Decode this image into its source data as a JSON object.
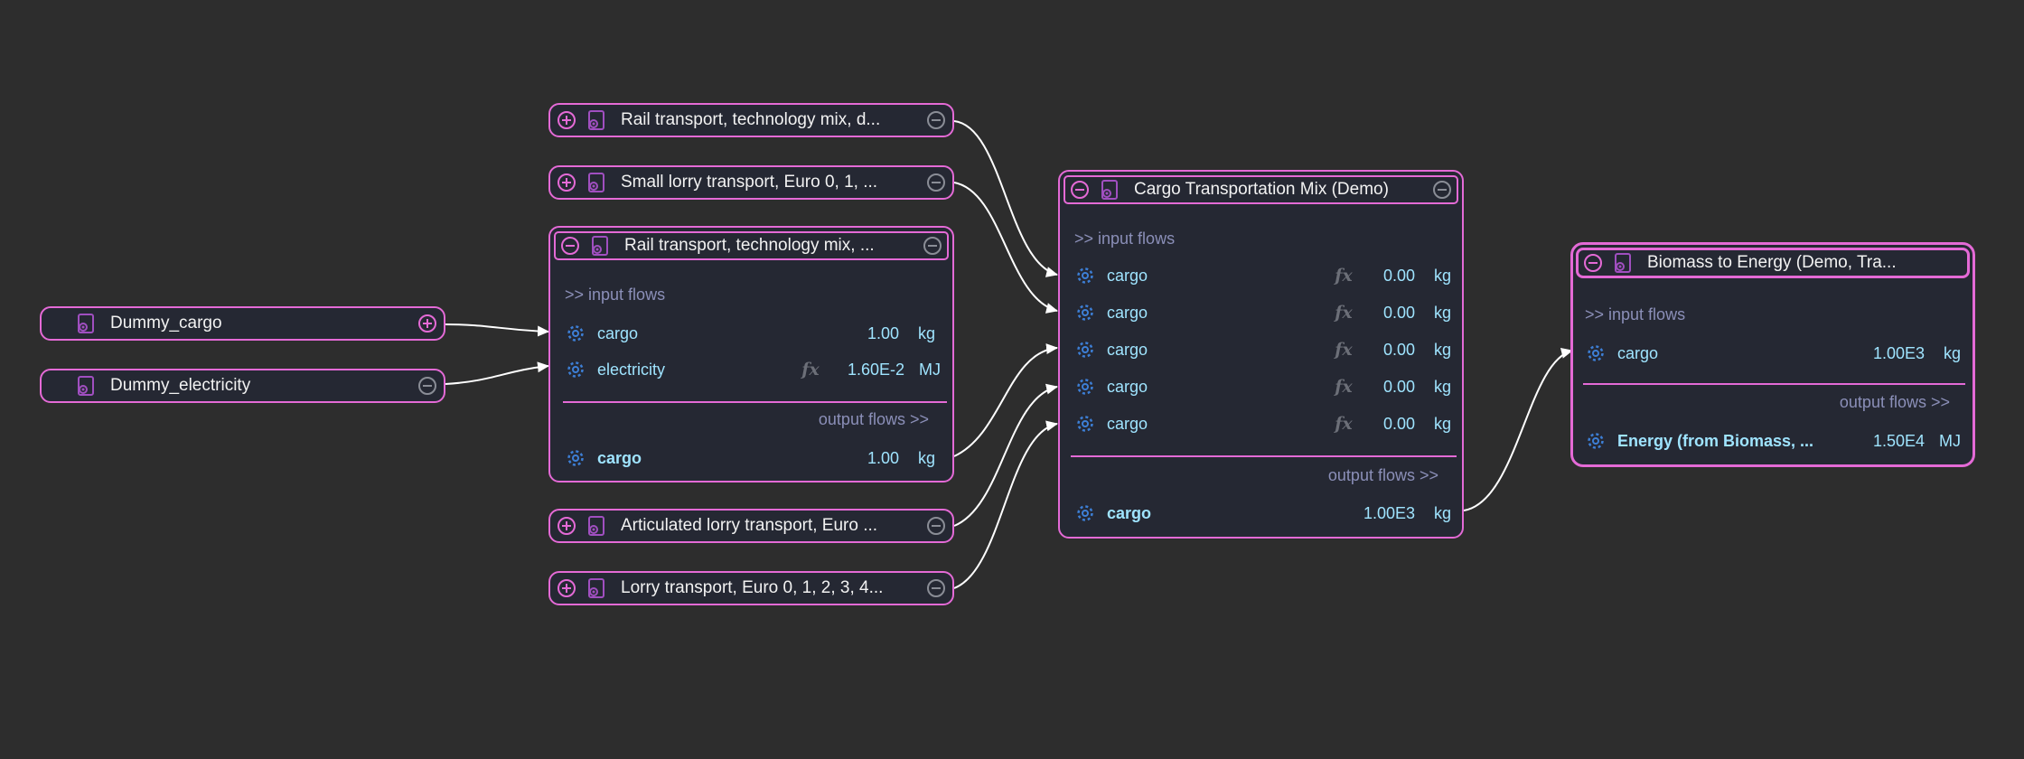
{
  "colors": {
    "node_border": "#e46ad6",
    "flow_text": "#9fe4ff",
    "section_text": "#8b8fb8",
    "background": "#2d2d2d",
    "edge": "#ffffff"
  },
  "nodes": {
    "dummy_cargo": {
      "title": "Dummy_cargo",
      "icon": "process-icon",
      "control": "plus-icon"
    },
    "dummy_electricity": {
      "title": "Dummy_electricity",
      "icon": "process-icon",
      "control": "minus-icon"
    },
    "rail_top": {
      "title": "Rail transport, technology mix, d...",
      "left_control": "plus-icon",
      "right_control": "minus-icon"
    },
    "small_lorry": {
      "title": "Small lorry transport, Euro 0, 1, ...",
      "left_control": "plus-icon",
      "right_control": "minus-icon"
    },
    "rail_expanded": {
      "title": "Rail transport, technology mix, ...",
      "input_label": ">> input flows",
      "output_label": "output flows >>",
      "inputs": [
        {
          "name": "cargo",
          "value": "1.00",
          "unit": "kg",
          "formula": false
        },
        {
          "name": "electricity",
          "value": "1.60E-2",
          "unit": "MJ",
          "formula": true
        }
      ],
      "outputs": [
        {
          "name": "cargo",
          "value": "1.00",
          "unit": "kg"
        }
      ]
    },
    "articulated_lorry": {
      "title": "Articulated lorry transport, Euro ...",
      "left_control": "plus-icon",
      "right_control": "minus-icon"
    },
    "lorry": {
      "title": "Lorry transport, Euro 0, 1, 2, 3, 4...",
      "left_control": "plus-icon",
      "right_control": "minus-icon"
    },
    "cargo_mix": {
      "title": "Cargo Transportation Mix (Demo)",
      "input_label": ">> input flows",
      "output_label": "output flows >>",
      "inputs": [
        {
          "name": "cargo",
          "value": "0.00",
          "unit": "kg",
          "formula": true
        },
        {
          "name": "cargo",
          "value": "0.00",
          "unit": "kg",
          "formula": true
        },
        {
          "name": "cargo",
          "value": "0.00",
          "unit": "kg",
          "formula": true
        },
        {
          "name": "cargo",
          "value": "0.00",
          "unit": "kg",
          "formula": true
        },
        {
          "name": "cargo",
          "value": "0.00",
          "unit": "kg",
          "formula": true
        }
      ],
      "outputs": [
        {
          "name": "cargo",
          "value": "1.00E3",
          "unit": "kg"
        }
      ]
    },
    "biomass": {
      "title": "Biomass to Energy (Demo, Tra...",
      "input_label": ">> input flows",
      "output_label": "output flows >>",
      "inputs": [
        {
          "name": "cargo",
          "value": "1.00E3",
          "unit": "kg",
          "formula": false
        }
      ],
      "outputs": [
        {
          "name": "Energy (from Biomass, ...",
          "value": "1.50E4",
          "unit": "MJ"
        }
      ]
    }
  },
  "formula_glyph": "fx"
}
